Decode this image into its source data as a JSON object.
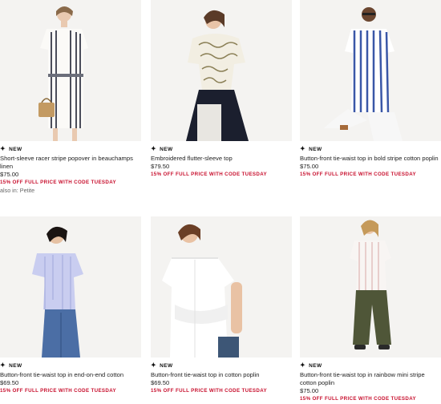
{
  "products": [
    {
      "badge": "NEW",
      "title": "Short-sleeve racer stripe popover in beauchamps linen",
      "price": "$75.00",
      "promo": "15% OFF FULL PRICE WITH CODE TUESDAY",
      "also_in": "also in: Petite"
    },
    {
      "badge": "NEW",
      "title": "Embroidered flutter-sleeve top",
      "price": "$79.50",
      "promo": "15% OFF FULL PRICE WITH CODE TUESDAY"
    },
    {
      "badge": "NEW",
      "title": "Button-front tie-waist top in bold stripe cotton poplin",
      "price": "$75.00",
      "promo": "15% OFF FULL PRICE WITH CODE TUESDAY"
    },
    {
      "badge": "NEW",
      "title": "Button-front tie-waist top in end-on-end cotton",
      "price": "$69.50",
      "promo": "15% OFF FULL PRICE WITH CODE TUESDAY"
    },
    {
      "badge": "NEW",
      "title": "Button-front tie-waist top in cotton poplin",
      "price": "$69.50",
      "promo": "15% OFF FULL PRICE WITH CODE TUESDAY"
    },
    {
      "badge": "NEW",
      "title": "Button-front tie-waist top in rainbow mini stripe cotton poplin",
      "price": "$75.00",
      "promo": "15% OFF FULL PRICE WITH CODE TUESDAY"
    }
  ],
  "colors": {
    "promo": "#c8102e",
    "photo_bg": "#f3f3f3"
  }
}
